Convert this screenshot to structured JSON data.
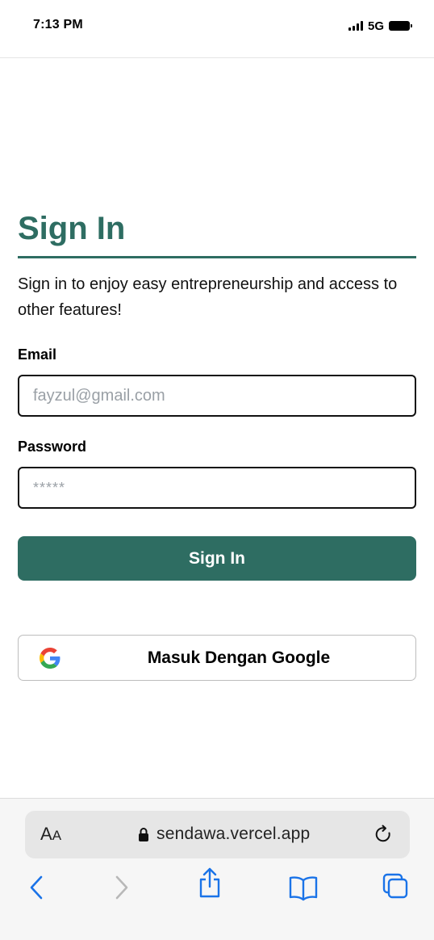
{
  "status_bar": {
    "time": "7:13 PM",
    "network": "5G"
  },
  "signin": {
    "title": "Sign In",
    "subtitle": "Sign in to enjoy easy entrepreneurship and access to other features!",
    "email_label": "Email",
    "email_placeholder": "fayzul@gmail.com",
    "password_label": "Password",
    "password_placeholder": "*****",
    "submit_label": "Sign In",
    "google_label": "Masuk Dengan Google"
  },
  "browser": {
    "text_size_label_big": "A",
    "text_size_label_small": "A",
    "url": "sendawa.vercel.app"
  },
  "colors": {
    "accent": "#2e6d62",
    "ios_blue": "#1a73e8"
  },
  "icons": {
    "google": "google-g-icon",
    "lock": "lock-icon",
    "reload": "reload-icon",
    "back": "chevron-left-icon",
    "forward": "chevron-right-icon",
    "share": "share-icon",
    "bookmarks": "book-icon",
    "tabs": "tabs-icon"
  }
}
